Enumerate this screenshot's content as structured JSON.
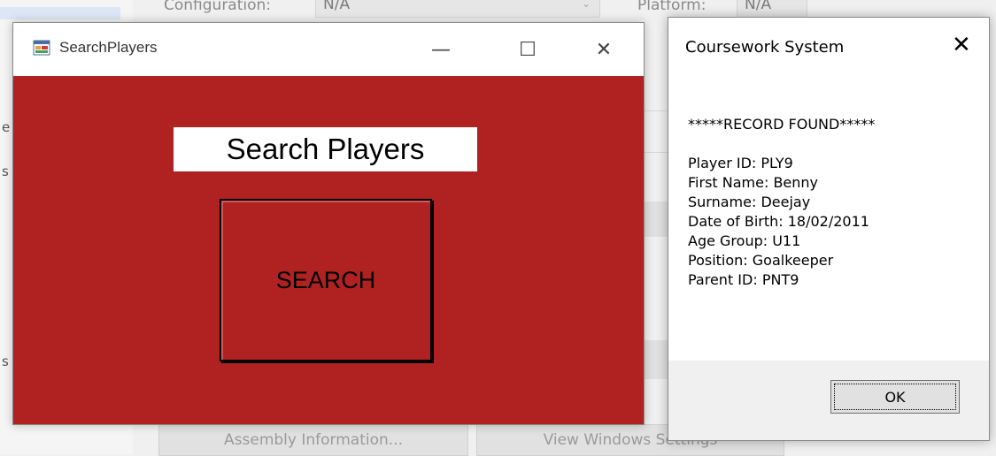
{
  "background": {
    "configuration_label": "Configuration:",
    "configuration_value": "N/A",
    "platform_label": "Platform:",
    "platform_value": "N/A",
    "assembly_button": "Assembly Information...",
    "view_windows_button": "View Windows Settings",
    "side_stubs": [
      "e",
      "s",
      "s"
    ]
  },
  "search_window": {
    "title": "SearchPlayers",
    "heading": "Search Players",
    "search_button": "SEARCH",
    "minimize_glyph": "—",
    "maximize_glyph": "☐",
    "close_glyph": "✕",
    "background_color": "#b02222"
  },
  "message_box": {
    "title": "Coursework System",
    "close_glyph": "✕",
    "header": "*****RECORD FOUND*****",
    "lines": [
      "Player ID: PLY9",
      "First Name: Benny",
      "Surname: Deejay",
      "Date of Birth: 18/02/2011",
      "Age Group: U11",
      "Position: Goalkeeper",
      "Parent ID: PNT9"
    ],
    "ok_button": "OK"
  }
}
